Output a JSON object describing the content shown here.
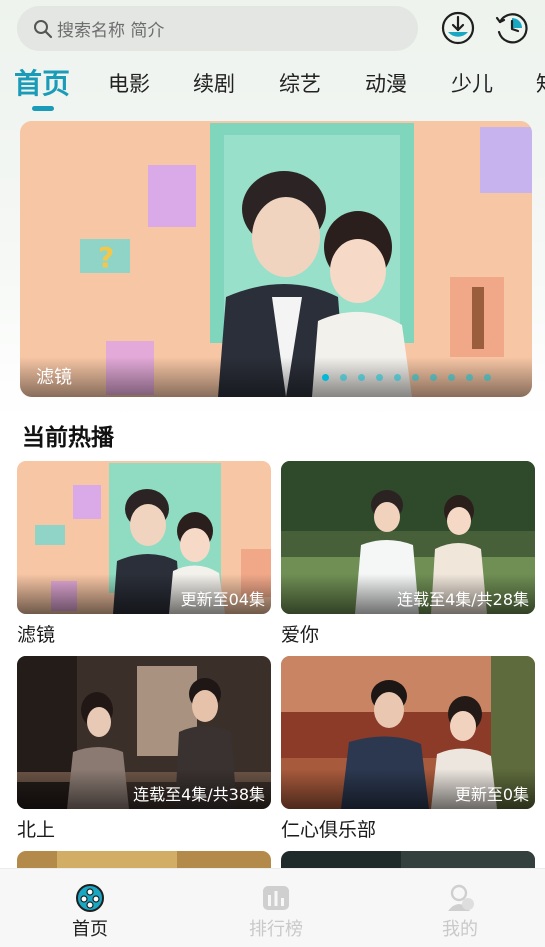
{
  "search": {
    "placeholder": "搜索名称 简介"
  },
  "header": {
    "download_icon": "download-icon",
    "history_icon": "history-icon"
  },
  "tabs": [
    {
      "label": "首页",
      "active": true
    },
    {
      "label": "电影"
    },
    {
      "label": "续剧"
    },
    {
      "label": "综艺"
    },
    {
      "label": "动漫"
    },
    {
      "label": "少儿"
    },
    {
      "label": "知"
    }
  ],
  "banner": {
    "caption": "滤镜",
    "slide_count": 10,
    "active_slide": 1
  },
  "section": {
    "title": "当前热播"
  },
  "cards": [
    {
      "title": "滤镜",
      "badge": "更新至04集"
    },
    {
      "title": "爱你",
      "badge": "连载至4集/共28集"
    },
    {
      "title": "北上",
      "badge": "连载至4集/共38集"
    },
    {
      "title": "仁心俱乐部",
      "badge": "更新至0集"
    }
  ],
  "bottom_nav": [
    {
      "label": "首页",
      "icon": "film-reel-icon",
      "active": true
    },
    {
      "label": "排行榜",
      "icon": "ranking-icon"
    },
    {
      "label": "我的",
      "icon": "profile-icon"
    }
  ],
  "colors": {
    "accent": "#1a9bb8",
    "inactive_nav": "#c9c9c9"
  }
}
